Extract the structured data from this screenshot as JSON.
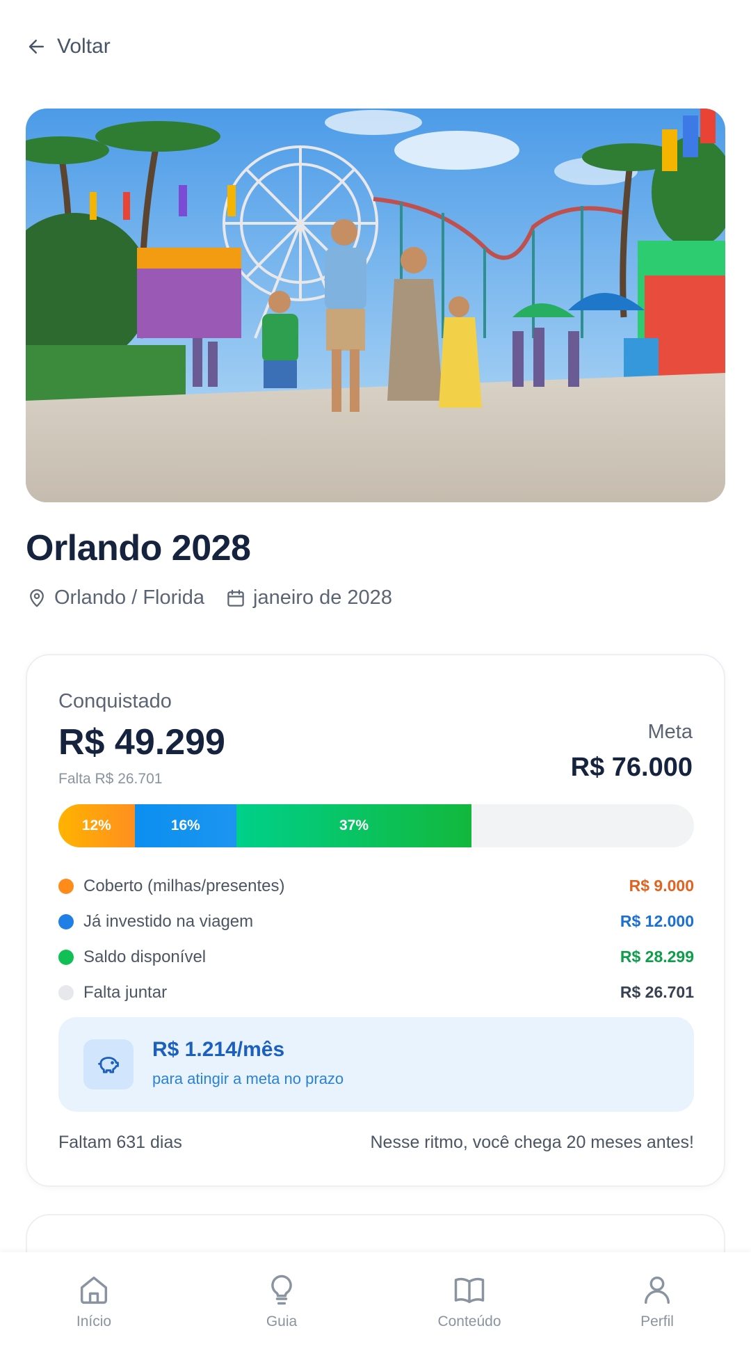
{
  "header": {
    "back_label": "Voltar"
  },
  "trip": {
    "title": "Orlando 2028",
    "location": "Orlando / Florida",
    "date": "janeiro de 2028"
  },
  "progress": {
    "achieved_label": "Conquistado",
    "achieved_value": "R$ 49.299",
    "remaining_small": "Falta R$ 26.701",
    "goal_label": "Meta",
    "goal_value": "R$ 76.000",
    "segments": [
      {
        "label": "12%",
        "percent": 12,
        "color": "#ff9f1a"
      },
      {
        "label": "16%",
        "percent": 16,
        "color": "#0b8ff0"
      },
      {
        "label": "37%",
        "percent": 37,
        "color": "#12c060"
      }
    ],
    "legend": [
      {
        "label": "Coberto (milhas/presentes)",
        "value": "R$ 9.000",
        "dot_color": "#ff8c1a",
        "value_color": "#e0631f"
      },
      {
        "label": "Já investido na viagem",
        "value": "R$ 12.000",
        "dot_color": "#1f7fe6",
        "value_color": "#1b6fd1"
      },
      {
        "label": "Saldo disponível",
        "value": "R$ 28.299",
        "dot_color": "#10c055",
        "value_color": "#0c9e48"
      },
      {
        "label": "Falta juntar",
        "value": "R$ 26.701",
        "dot_color": "#e6e8eb",
        "value_color": "#374151"
      }
    ],
    "monthly_value": "R$ 1.214/mês",
    "monthly_sub": "para atingir a meta no prazo",
    "days_left": "Faltam 631 dias",
    "pace_note": "Nesse ritmo, você chega 20 meses antes!"
  },
  "nav": {
    "items": [
      {
        "label": "Início",
        "icon": "home-icon"
      },
      {
        "label": "Guia",
        "icon": "lightbulb-icon"
      },
      {
        "label": "Conteúdo",
        "icon": "book-icon"
      },
      {
        "label": "Perfil",
        "icon": "user-icon"
      }
    ]
  }
}
